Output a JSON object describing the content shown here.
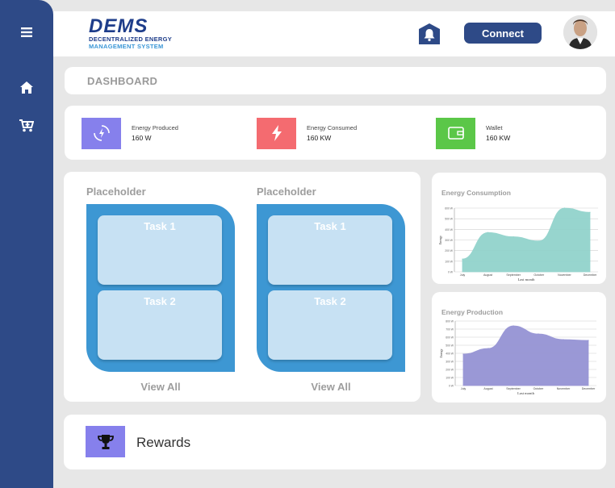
{
  "sidebar": {
    "menu_icon": "hamburger-menu-icon",
    "items": [
      {
        "name": "home",
        "icon": "home-icon"
      },
      {
        "name": "cart",
        "icon": "cart-icon"
      }
    ],
    "color": "#2e4a87"
  },
  "header": {
    "logo_mark": "DEMS",
    "logo_line1": "DECENTRALIZED ENERGY",
    "logo_line2": "MANAGEMENT SYSTEM",
    "connect_label": "Connect",
    "bell_icon": "bell-icon"
  },
  "dashboard": {
    "title": "DASHBOARD"
  },
  "stats": [
    {
      "label": "Energy Produced",
      "value": "160 W",
      "color": "#8680ec",
      "icon": "energy-produced-icon"
    },
    {
      "label": "Energy Consumed",
      "value": "160 KW",
      "color": "#f46b70",
      "icon": "lightning-icon"
    },
    {
      "label": "Wallet",
      "value": "160 KW",
      "color": "#5bc748",
      "icon": "wallet-icon"
    }
  ],
  "task_columns": [
    {
      "heading": "Placeholder",
      "tasks": [
        "Task 1",
        "Task 2"
      ],
      "view_all": "View All"
    },
    {
      "heading": "Placeholder",
      "tasks": [
        "Task 1",
        "Task 2"
      ],
      "view_all": "View All"
    }
  ],
  "charts": {
    "consumption_title": "Energy Consumption",
    "production_title": "Energy Production"
  },
  "chart_data": [
    {
      "type": "area",
      "title": "Energy Consumption",
      "xlabel": "Last month",
      "ylabel": "Energy",
      "x": [
        "July",
        "August",
        "September",
        "October",
        "November",
        "December"
      ],
      "values": [
        120,
        370,
        330,
        290,
        600,
        560
      ],
      "ylim": [
        0,
        600
      ],
      "yticks": [
        "0 W",
        "100 W",
        "200 W",
        "300 W",
        "400 W",
        "500 W",
        "600 W"
      ],
      "color": "#92d3cc"
    },
    {
      "type": "area",
      "title": "Energy Production",
      "xlabel": "Last month",
      "ylabel": "Energy",
      "x": [
        "July",
        "August",
        "September",
        "October",
        "November",
        "December"
      ],
      "values": [
        390,
        460,
        740,
        640,
        570,
        560
      ],
      "ylim": [
        0,
        800
      ],
      "yticks": [
        "0 W",
        "100 W",
        "200 W",
        "300 W",
        "400 W",
        "500 W",
        "600 W",
        "700 W",
        "800 W"
      ],
      "color": "#9593d4"
    }
  ],
  "rewards": {
    "label": "Rewards",
    "icon": "trophy-icon",
    "color": "#8680ec"
  }
}
